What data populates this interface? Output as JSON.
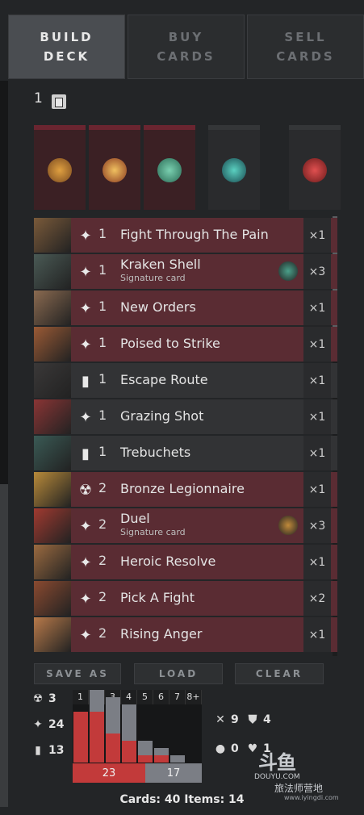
{
  "tabs": [
    {
      "label": "BUILD\nDECK",
      "active": true
    },
    {
      "label": "BUY\nCARDS",
      "active": false
    },
    {
      "label": "SELL\nCARDS",
      "active": false
    }
  ],
  "deck_count": "1",
  "cards": [
    {
      "name": "Fight Through The Pain",
      "cost": "1",
      "type": "spell",
      "qty": "×1",
      "color": "red",
      "thumb": "#7a5a3a"
    },
    {
      "name": "Kraken Shell",
      "sub": "Signature card",
      "cost": "1",
      "type": "spell",
      "qty": "×3",
      "color": "red",
      "thumb": "#4a5a55",
      "sig": "#4aa08a"
    },
    {
      "name": "New Orders",
      "cost": "1",
      "type": "spell",
      "qty": "×1",
      "color": "red",
      "thumb": "#8a6a50"
    },
    {
      "name": "Poised to Strike",
      "cost": "1",
      "type": "spell",
      "qty": "×1",
      "color": "red",
      "thumb": "#9a5a35"
    },
    {
      "name": "Escape Route",
      "cost": "1",
      "type": "improvement",
      "qty": "×1",
      "color": "black",
      "thumb": "#3a3838"
    },
    {
      "name": "Grazing Shot",
      "cost": "1",
      "type": "spell",
      "qty": "×1",
      "color": "black",
      "thumb": "#8a3535"
    },
    {
      "name": "Trebuchets",
      "cost": "1",
      "type": "improvement",
      "qty": "×1",
      "color": "black",
      "thumb": "#3a5a55"
    },
    {
      "name": "Bronze Legionnaire",
      "cost": "2",
      "type": "creep",
      "qty": "×1",
      "color": "red",
      "thumb": "#b88a3a"
    },
    {
      "name": "Duel",
      "sub": "Signature card",
      "cost": "2",
      "type": "spell",
      "qty": "×3",
      "color": "red",
      "thumb": "#a03a30",
      "sig": "#c08a3a"
    },
    {
      "name": "Heroic Resolve",
      "cost": "2",
      "type": "spell",
      "qty": "×1",
      "color": "red",
      "thumb": "#9a6a40"
    },
    {
      "name": "Pick A Fight",
      "cost": "2",
      "type": "spell",
      "qty": "×2",
      "color": "red",
      "thumb": "#8a4a30"
    },
    {
      "name": "Rising Anger",
      "cost": "2",
      "type": "spell",
      "qty": "×1",
      "color": "red",
      "thumb": "#b87a4a"
    }
  ],
  "buttons": {
    "save_as": "SAVE AS",
    "load": "LOAD",
    "clear": "CLEAR"
  },
  "stats_left": [
    {
      "icon": "creep-icon",
      "glyph": "☢",
      "value": "3"
    },
    {
      "icon": "spell-icon",
      "glyph": "✦",
      "value": "24"
    },
    {
      "icon": "improvement-icon",
      "glyph": "▮",
      "value": "13"
    }
  ],
  "curve": {
    "labels": [
      "1",
      "2",
      "3",
      "4",
      "5",
      "6",
      "7",
      "8+"
    ],
    "red_values": [
      7,
      7,
      4,
      3,
      1,
      1,
      0,
      0
    ],
    "grey_values": [
      0,
      3,
      5,
      5,
      2,
      1,
      1,
      0
    ],
    "red_total": "23",
    "grey_total": "17"
  },
  "stats_right": [
    {
      "icon": "cross-icon",
      "glyph": "✕",
      "value": "9"
    },
    {
      "icon": "shield-icon",
      "glyph": "⛊",
      "value": "4"
    },
    {
      "icon": "drop-icon",
      "glyph": "●",
      "value": "0"
    },
    {
      "icon": "heart-icon",
      "glyph": "♥",
      "value": "1"
    }
  ],
  "footer": "Cards: 40  Items: 14",
  "watermark": {
    "logo": "斗鱼",
    "text": "DOUYU.COM",
    "site": "旅法师营地",
    "url": "www.iyingdi.com"
  },
  "colors": {
    "red_card": "#5a2c33",
    "black_card": "#323335",
    "accent_red": "#c23a3a",
    "accent_grey": "#7b7e85"
  }
}
